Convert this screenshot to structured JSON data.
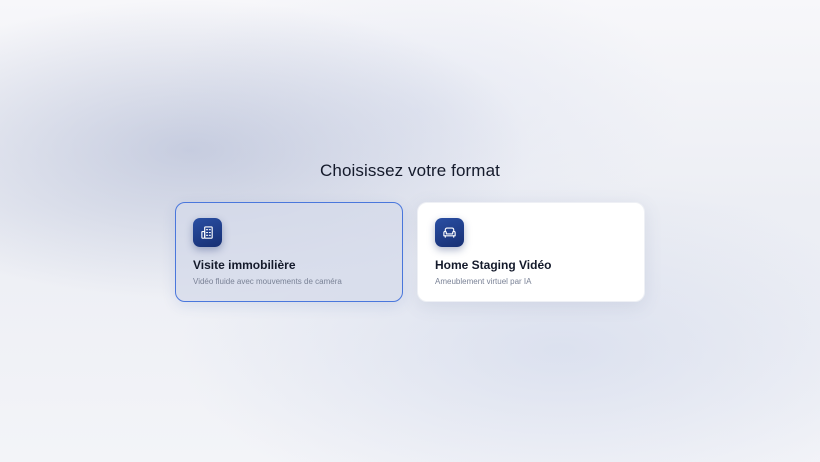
{
  "page": {
    "title": "Choisissez votre format"
  },
  "cards": [
    {
      "title": "Visite immobilière",
      "subtitle": "Vidéo fluide avec mouvements de caméra",
      "icon": "building-icon",
      "selected": true
    },
    {
      "title": "Home Staging Vidéo",
      "subtitle": "Ameublement virtuel par IA",
      "icon": "sofa-icon",
      "selected": false
    }
  ],
  "colors": {
    "accent": "#4a77dc",
    "icon_bg": "#1f3f8f",
    "text_primary": "#141a2b",
    "text_secondary": "#7a8296"
  }
}
